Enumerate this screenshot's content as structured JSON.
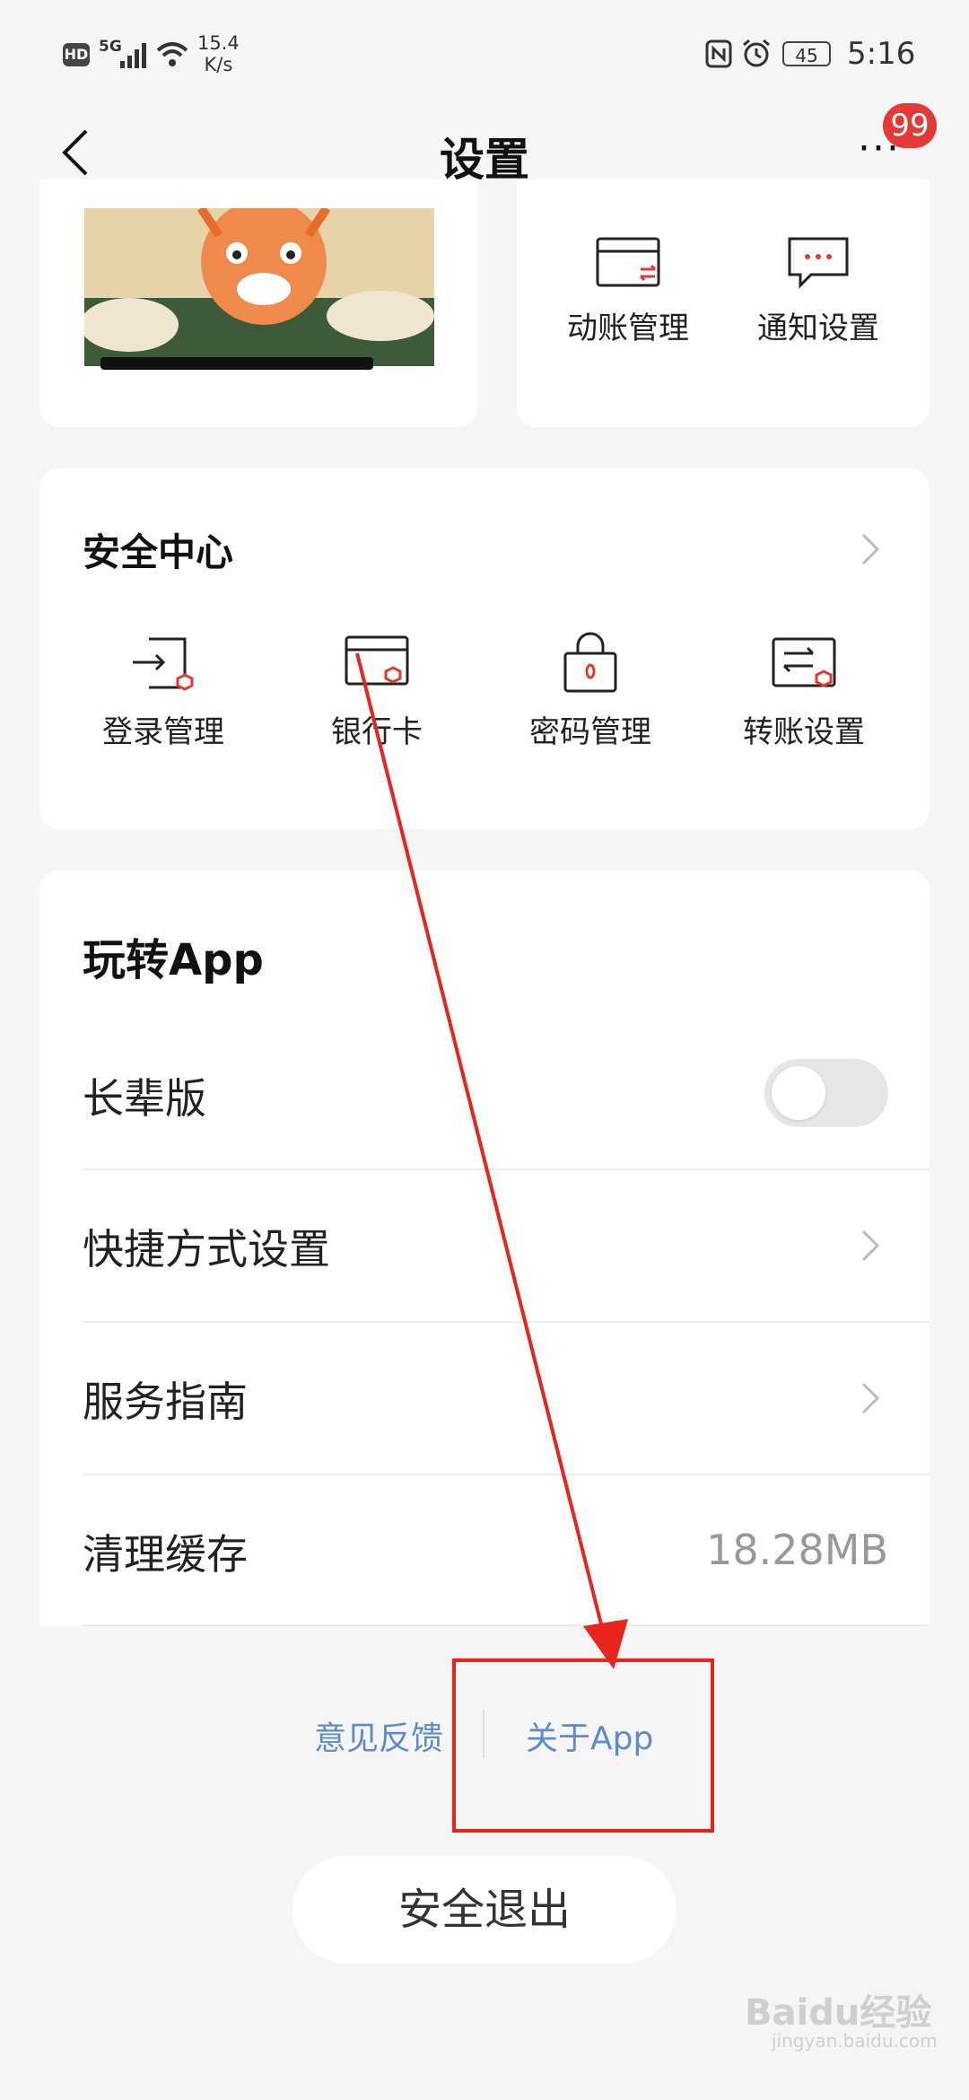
{
  "status": {
    "hd": "HD",
    "network": "5G",
    "speed_value": "15.4",
    "speed_unit": "K/s",
    "battery": "45",
    "time": "5:16"
  },
  "nav": {
    "title": "设置",
    "more": "···",
    "badge": "99"
  },
  "quick": {
    "items": [
      {
        "label": "动账管理",
        "icon": "transfer-card-icon"
      },
      {
        "label": "通知设置",
        "icon": "chat-bubble-icon"
      }
    ]
  },
  "security": {
    "title": "安全中心",
    "items": [
      {
        "label": "登录管理",
        "icon": "login-icon"
      },
      {
        "label": "银行卡",
        "icon": "bank-card-icon"
      },
      {
        "label": "密码管理",
        "icon": "lock-icon"
      },
      {
        "label": "转账设置",
        "icon": "transfer-icon"
      }
    ]
  },
  "play": {
    "title": "玩转App",
    "elder_mode": "长辈版",
    "shortcut": "快捷方式设置",
    "guide": "服务指南",
    "clear_cache": "清理缓存",
    "cache_size": "18.28MB"
  },
  "footer": {
    "feedback": "意见反馈",
    "about": "关于App",
    "logout": "安全退出"
  },
  "watermark": {
    "brand": "Baidu经验",
    "site": "jingyan.baidu.com"
  },
  "colors": {
    "accent": "#e53935",
    "link": "#5b8bd1",
    "annotation": "#e8241c"
  }
}
